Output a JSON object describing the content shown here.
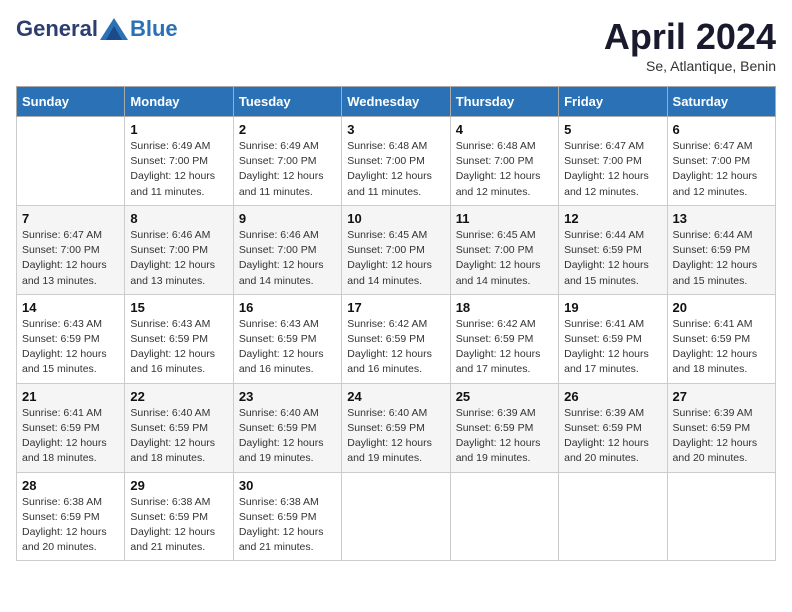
{
  "header": {
    "logo_general": "General",
    "logo_blue": "Blue",
    "month_title": "April 2024",
    "subtitle": "Se, Atlantique, Benin"
  },
  "days_of_week": [
    "Sunday",
    "Monday",
    "Tuesday",
    "Wednesday",
    "Thursday",
    "Friday",
    "Saturday"
  ],
  "weeks": [
    [
      null,
      {
        "num": "1",
        "sunrise": "6:49 AM",
        "sunset": "7:00 PM",
        "daylight": "12 hours and 11 minutes."
      },
      {
        "num": "2",
        "sunrise": "6:49 AM",
        "sunset": "7:00 PM",
        "daylight": "12 hours and 11 minutes."
      },
      {
        "num": "3",
        "sunrise": "6:48 AM",
        "sunset": "7:00 PM",
        "daylight": "12 hours and 11 minutes."
      },
      {
        "num": "4",
        "sunrise": "6:48 AM",
        "sunset": "7:00 PM",
        "daylight": "12 hours and 12 minutes."
      },
      {
        "num": "5",
        "sunrise": "6:47 AM",
        "sunset": "7:00 PM",
        "daylight": "12 hours and 12 minutes."
      },
      {
        "num": "6",
        "sunrise": "6:47 AM",
        "sunset": "7:00 PM",
        "daylight": "12 hours and 12 minutes."
      }
    ],
    [
      {
        "num": "7",
        "sunrise": "6:47 AM",
        "sunset": "7:00 PM",
        "daylight": "12 hours and 13 minutes."
      },
      {
        "num": "8",
        "sunrise": "6:46 AM",
        "sunset": "7:00 PM",
        "daylight": "12 hours and 13 minutes."
      },
      {
        "num": "9",
        "sunrise": "6:46 AM",
        "sunset": "7:00 PM",
        "daylight": "12 hours and 14 minutes."
      },
      {
        "num": "10",
        "sunrise": "6:45 AM",
        "sunset": "7:00 PM",
        "daylight": "12 hours and 14 minutes."
      },
      {
        "num": "11",
        "sunrise": "6:45 AM",
        "sunset": "7:00 PM",
        "daylight": "12 hours and 14 minutes."
      },
      {
        "num": "12",
        "sunrise": "6:44 AM",
        "sunset": "6:59 PM",
        "daylight": "12 hours and 15 minutes."
      },
      {
        "num": "13",
        "sunrise": "6:44 AM",
        "sunset": "6:59 PM",
        "daylight": "12 hours and 15 minutes."
      }
    ],
    [
      {
        "num": "14",
        "sunrise": "6:43 AM",
        "sunset": "6:59 PM",
        "daylight": "12 hours and 15 minutes."
      },
      {
        "num": "15",
        "sunrise": "6:43 AM",
        "sunset": "6:59 PM",
        "daylight": "12 hours and 16 minutes."
      },
      {
        "num": "16",
        "sunrise": "6:43 AM",
        "sunset": "6:59 PM",
        "daylight": "12 hours and 16 minutes."
      },
      {
        "num": "17",
        "sunrise": "6:42 AM",
        "sunset": "6:59 PM",
        "daylight": "12 hours and 16 minutes."
      },
      {
        "num": "18",
        "sunrise": "6:42 AM",
        "sunset": "6:59 PM",
        "daylight": "12 hours and 17 minutes."
      },
      {
        "num": "19",
        "sunrise": "6:41 AM",
        "sunset": "6:59 PM",
        "daylight": "12 hours and 17 minutes."
      },
      {
        "num": "20",
        "sunrise": "6:41 AM",
        "sunset": "6:59 PM",
        "daylight": "12 hours and 18 minutes."
      }
    ],
    [
      {
        "num": "21",
        "sunrise": "6:41 AM",
        "sunset": "6:59 PM",
        "daylight": "12 hours and 18 minutes."
      },
      {
        "num": "22",
        "sunrise": "6:40 AM",
        "sunset": "6:59 PM",
        "daylight": "12 hours and 18 minutes."
      },
      {
        "num": "23",
        "sunrise": "6:40 AM",
        "sunset": "6:59 PM",
        "daylight": "12 hours and 19 minutes."
      },
      {
        "num": "24",
        "sunrise": "6:40 AM",
        "sunset": "6:59 PM",
        "daylight": "12 hours and 19 minutes."
      },
      {
        "num": "25",
        "sunrise": "6:39 AM",
        "sunset": "6:59 PM",
        "daylight": "12 hours and 19 minutes."
      },
      {
        "num": "26",
        "sunrise": "6:39 AM",
        "sunset": "6:59 PM",
        "daylight": "12 hours and 20 minutes."
      },
      {
        "num": "27",
        "sunrise": "6:39 AM",
        "sunset": "6:59 PM",
        "daylight": "12 hours and 20 minutes."
      }
    ],
    [
      {
        "num": "28",
        "sunrise": "6:38 AM",
        "sunset": "6:59 PM",
        "daylight": "12 hours and 20 minutes."
      },
      {
        "num": "29",
        "sunrise": "6:38 AM",
        "sunset": "6:59 PM",
        "daylight": "12 hours and 21 minutes."
      },
      {
        "num": "30",
        "sunrise": "6:38 AM",
        "sunset": "6:59 PM",
        "daylight": "12 hours and 21 minutes."
      },
      null,
      null,
      null,
      null
    ]
  ],
  "labels": {
    "sunrise": "Sunrise:",
    "sunset": "Sunset:",
    "daylight": "Daylight:"
  }
}
